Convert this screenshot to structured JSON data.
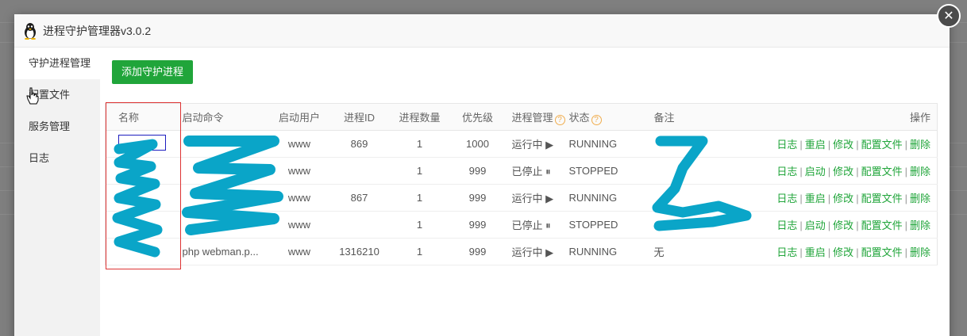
{
  "window": {
    "title": "进程守护管理器v3.0.2",
    "close_symbol": "✕"
  },
  "sidebar": {
    "items": [
      {
        "label": "守护进程管理",
        "active": true
      },
      {
        "label": "配置文件",
        "active": false
      },
      {
        "label": "服务管理",
        "active": false
      },
      {
        "label": "日志",
        "active": false
      }
    ]
  },
  "toolbar": {
    "add_label": "添加守护进程"
  },
  "table": {
    "headers": {
      "name": "名称",
      "cmd": "启动命令",
      "user": "启动用户",
      "pid": "进程ID",
      "num": "进程数量",
      "priority": "优先级",
      "manage": "进程管理",
      "state": "状态",
      "note": "备注",
      "ops": "操作"
    },
    "help_symbol": "?",
    "rows": [
      {
        "name": "",
        "cmd": "",
        "user": "www",
        "pid": "869",
        "num": "1",
        "priority": "1000",
        "manage": "运行中",
        "manage_icon": "▶",
        "running": true,
        "state": "RUNNING",
        "note": "",
        "action": "重启"
      },
      {
        "name": "",
        "cmd": "",
        "user": "www",
        "pid": "",
        "num": "1",
        "priority": "999",
        "manage": "已停止",
        "manage_icon": "⏸",
        "running": false,
        "state": "STOPPED",
        "note": "",
        "action": "启动"
      },
      {
        "name": "",
        "cmd": "",
        "user": "www",
        "pid": "867",
        "num": "1",
        "priority": "999",
        "manage": "运行中",
        "manage_icon": "▶",
        "running": true,
        "state": "RUNNING",
        "note": "",
        "action": "重启"
      },
      {
        "name": "",
        "cmd": "",
        "user": "www",
        "pid": "",
        "num": "1",
        "priority": "999",
        "manage": "已停止",
        "manage_icon": "⏸",
        "running": false,
        "state": "STOPPED",
        "note": "",
        "action": "启动"
      },
      {
        "name": "",
        "cmd": "php webman.p...",
        "user": "www",
        "pid": "1316210",
        "num": "1",
        "priority": "999",
        "manage": "运行中",
        "manage_icon": "▶",
        "running": true,
        "state": "RUNNING",
        "note": "无",
        "action": "重启"
      }
    ],
    "ops": {
      "log": "日志",
      "edit": "修改",
      "config": "配置文件",
      "delete": "删除",
      "sep": "|"
    }
  },
  "colors": {
    "accent": "#20a53a",
    "stopped": "#e02020",
    "scribble": "#0aa5c8",
    "highlight_box": "#d33333"
  }
}
